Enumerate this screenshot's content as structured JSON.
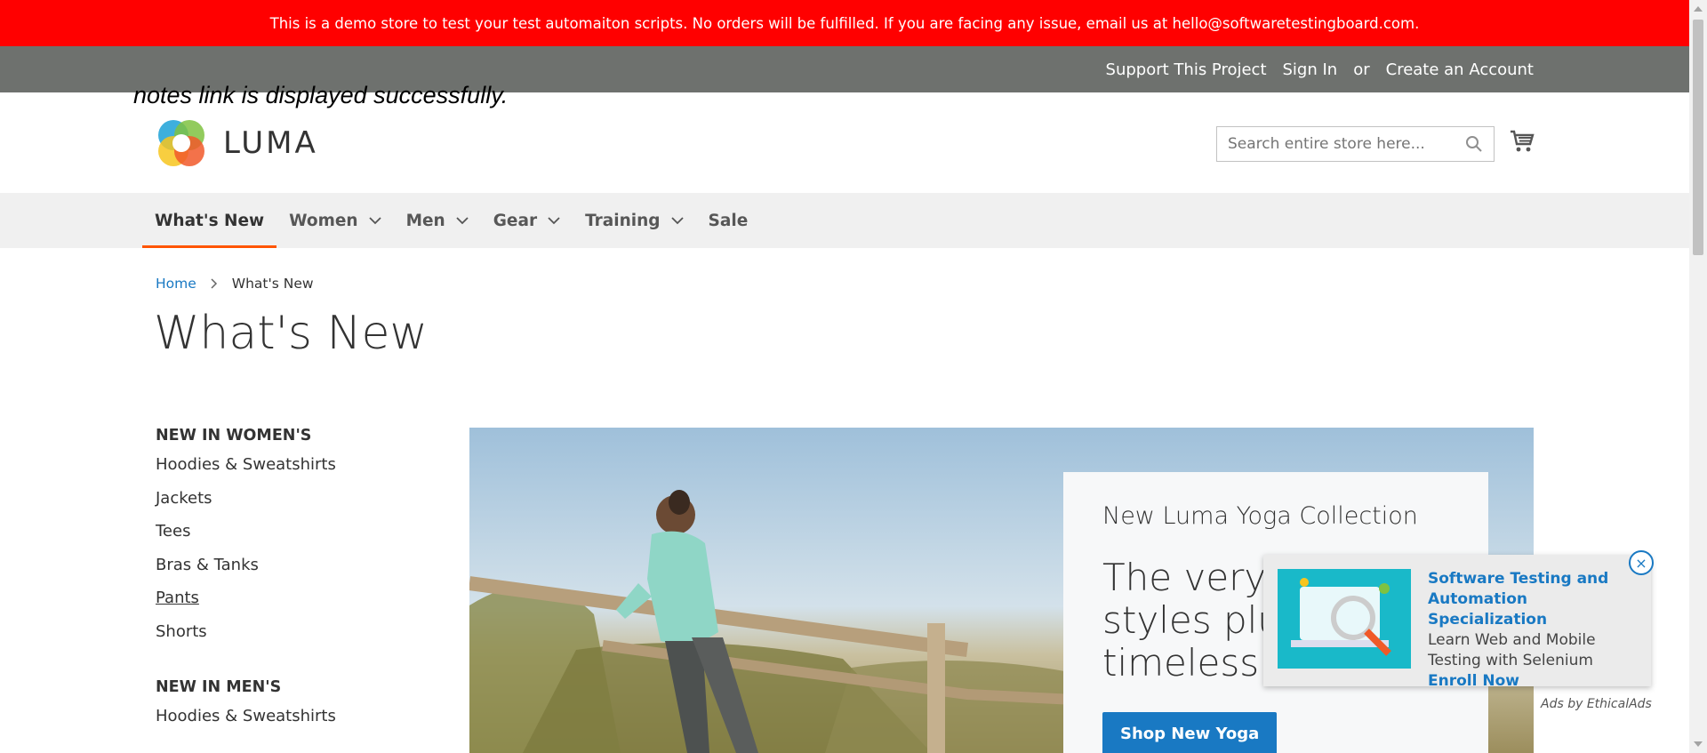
{
  "banner": {
    "text": "This is a demo store to test your test automaiton scripts. No orders will be fulfilled. If you are facing any issue, email us at hello@softwaretestingboard.com."
  },
  "top_bar": {
    "support": "Support This Project",
    "sign_in": "Sign In",
    "or": "or",
    "create_account": "Create an Account"
  },
  "overlay_note": "notes link is displayed successfully.",
  "header": {
    "logo_text": "LUMA",
    "search_placeholder": "Search entire store here..."
  },
  "nav": {
    "items": [
      {
        "label": "What's New",
        "active": true,
        "dropdown": false
      },
      {
        "label": "Women",
        "dropdown": true
      },
      {
        "label": "Men",
        "dropdown": true
      },
      {
        "label": "Gear",
        "dropdown": true
      },
      {
        "label": "Training",
        "dropdown": true
      },
      {
        "label": "Sale",
        "dropdown": false
      }
    ]
  },
  "breadcrumb": {
    "home": "Home",
    "current": "What's New"
  },
  "page_title": "What's New",
  "sidebar": {
    "women_heading": "NEW IN WOMEN'S",
    "women_items": [
      "Hoodies & Sweatshirts",
      "Jackets",
      "Tees",
      "Bras & Tanks",
      "Pants",
      "Shorts"
    ],
    "men_heading": "NEW IN MEN'S",
    "men_items": [
      "Hoodies & Sweatshirts"
    ]
  },
  "hero": {
    "kicker": "New Luma Yoga Collection",
    "headline_1": "The very la",
    "headline_2": "styles plus",
    "headline_3": "timeless cl",
    "cta": "Shop New Yoga"
  },
  "ad": {
    "title": "Software Testing and Automation Specialization",
    "body": "Learn Web and Mobile Testing with Selenium",
    "cta": "Enroll Now",
    "by": "Ads by EthicalAds",
    "close": "×"
  },
  "colors": {
    "banner_bg": "#ff0000",
    "topbar_bg": "#6e716e",
    "nav_bg": "#f0f0f0",
    "accent": "#ff5501",
    "link": "#1979c3"
  }
}
